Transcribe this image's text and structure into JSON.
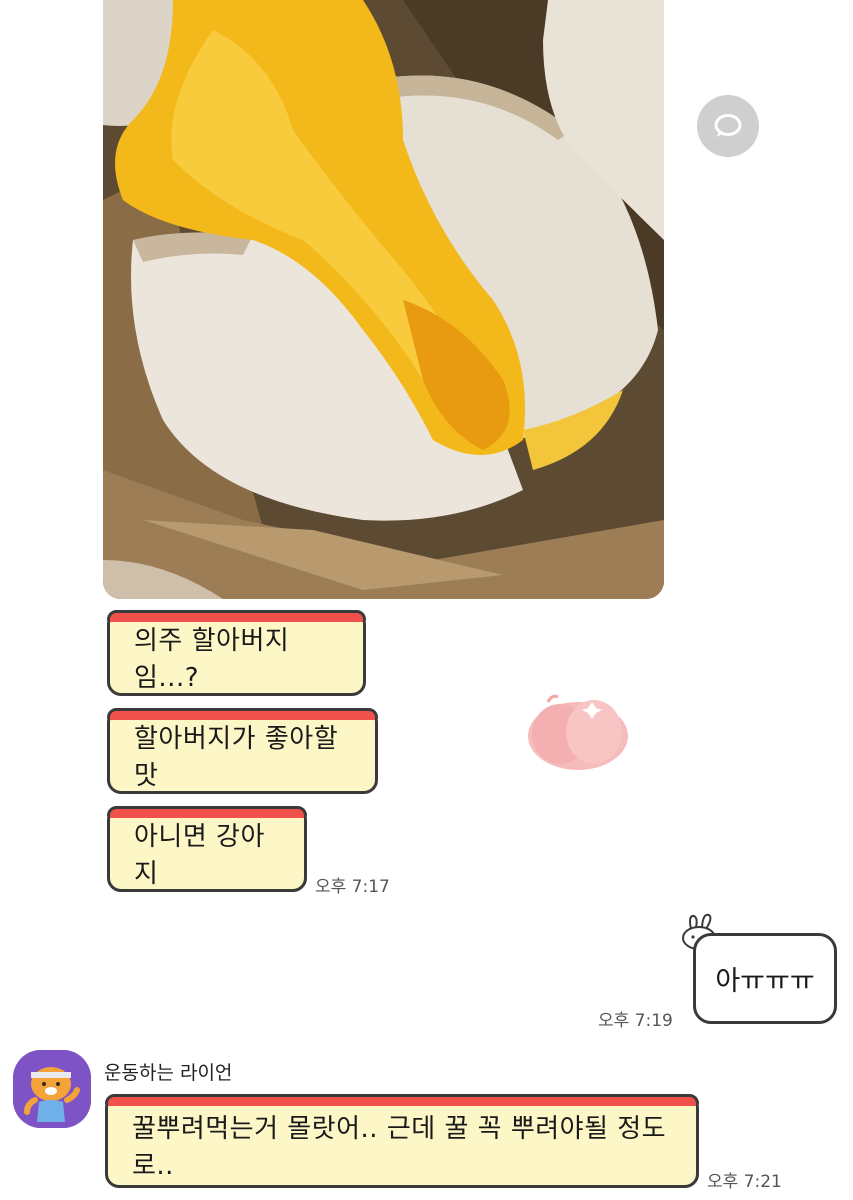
{
  "messages": [
    {
      "text": "의주 할아버지임...?"
    },
    {
      "text": "할아버지가 좋아할맛"
    },
    {
      "text": "아니면 강아지"
    }
  ],
  "times": {
    "received_1": "오후 7:17",
    "sent_1": "오후 7:19",
    "received_2": "오후 7:21"
  },
  "sent": {
    "text": "아ㅠㅠㅠ"
  },
  "sender": {
    "name": "운동하는 라이언",
    "message": "꿀뿌려먹는거 몰랏어.. 근데 꿀 꼭 뿌려야될 정도로.."
  },
  "colors": {
    "bubble_fill": "#fdf6c7",
    "bubble_top": "#f0524b",
    "avatar_bg": "#7d53c5"
  },
  "icons": [
    "share-icon",
    "apple-sticker",
    "bunny-sticker",
    "lion-avatar"
  ]
}
